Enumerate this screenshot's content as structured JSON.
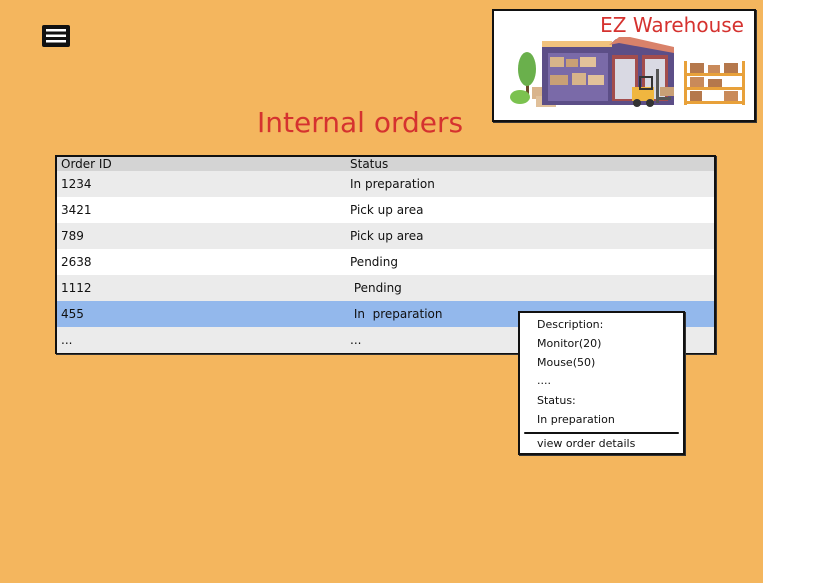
{
  "app": {
    "title": "EZ Warehouse"
  },
  "header": {
    "menu_icon": "hamburger-menu-icon",
    "logo_image": "warehouse-illustration"
  },
  "page": {
    "title": "Internal orders"
  },
  "table": {
    "columns": [
      "Order ID",
      "Status"
    ],
    "rows": [
      {
        "id": "1234",
        "status": "In preparation"
      },
      {
        "id": "3421",
        "status": "Pick up area"
      },
      {
        "id": "789",
        "status": "Pick up area"
      },
      {
        "id": "2638",
        "status": "Pending"
      },
      {
        "id": "1112",
        "status": " Pending"
      },
      {
        "id": "455",
        "status": " In  preparation"
      },
      {
        "id": "...",
        "status": "..."
      }
    ],
    "selected_row": 5
  },
  "popup": {
    "description_label": "Description:",
    "items": [
      "Monitor(20)",
      "Mouse(50)",
      "...."
    ],
    "status_label": "Status:",
    "status_value": "In preparation",
    "link": "view order details"
  },
  "colors": {
    "background": "#f4b65e",
    "accent": "#d5322f",
    "selected_row": "#93b8ec"
  }
}
